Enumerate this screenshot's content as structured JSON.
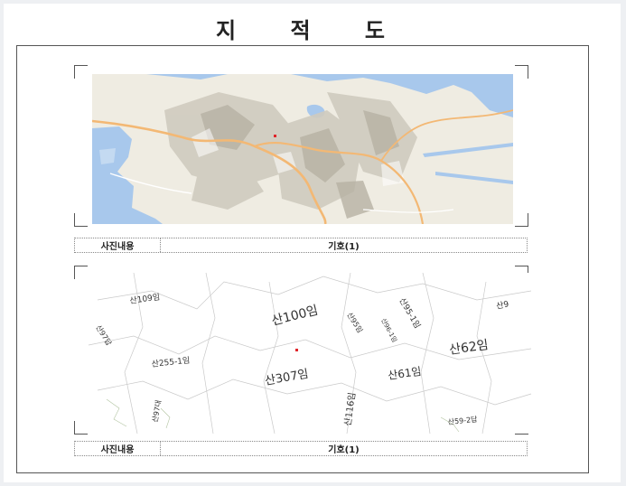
{
  "document": {
    "title": "지 적 도"
  },
  "sections": [
    {
      "caption_label": "사진내용",
      "caption_value": "기호(1)"
    },
    {
      "caption_label": "사진내용",
      "caption_value": "기호(1)"
    }
  ],
  "cadastral": {
    "parcels": [
      "산109임",
      "산97답",
      "산100임",
      "산95-1임",
      "산9",
      "산95임",
      "산96-1임",
      "산62임",
      "산255-1임",
      "산307임",
      "산61임",
      "산116임",
      "산59-2답",
      "산97대"
    ]
  },
  "colors": {
    "water": "#a8c8ec",
    "land": "#efece2",
    "road": "#f3b874",
    "marker": "#e0252a"
  }
}
